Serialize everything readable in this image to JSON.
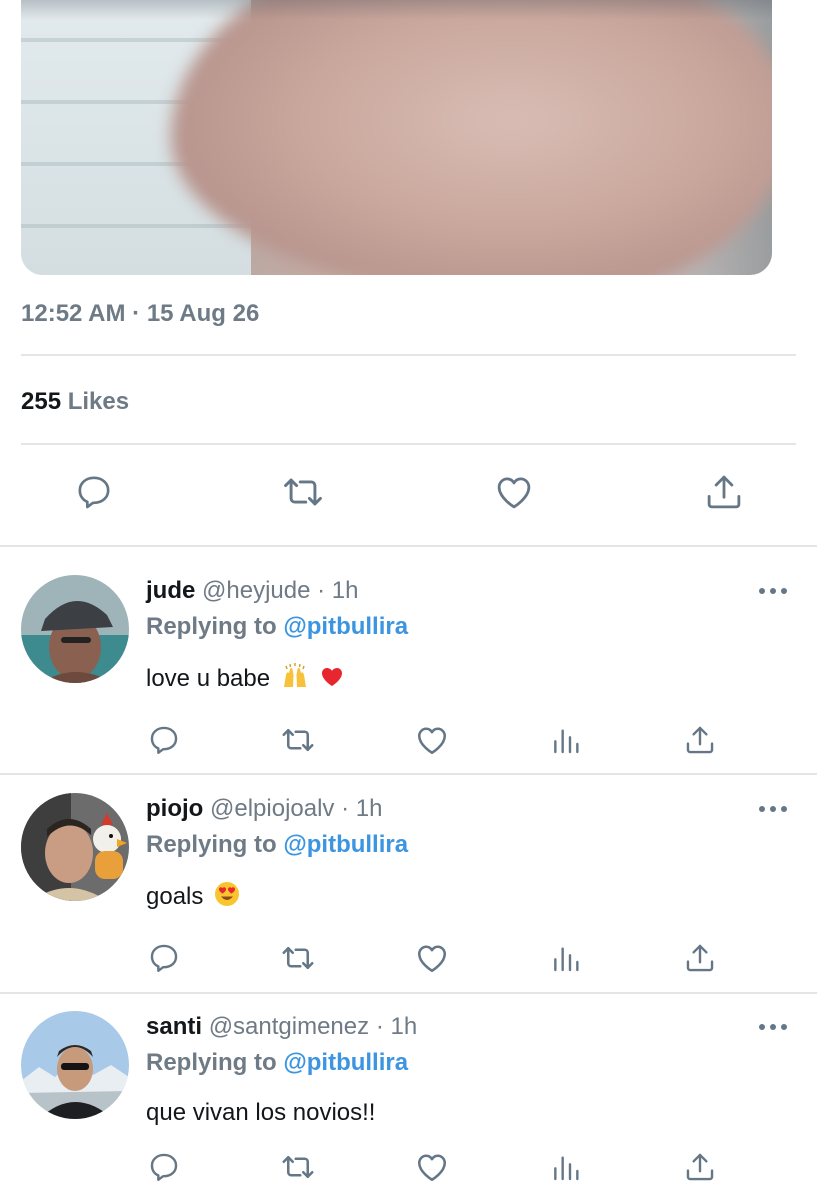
{
  "tweet": {
    "timestamp": "12:52 AM · 15 Aug 26",
    "likes_count": "255",
    "likes_label": "Likes",
    "actions": [
      "reply-icon",
      "retweet-icon",
      "like-icon",
      "share-icon"
    ]
  },
  "replies": [
    {
      "name": "jude",
      "handle": "@heyjude",
      "time": "· 1h",
      "replying_prefix": "Replying to",
      "replying_to": "@pitbullira",
      "text": "love u babe",
      "emojis": [
        "raising-hands-emoji",
        "red-heart-emoji"
      ]
    },
    {
      "name": "piojo",
      "handle": "@elpiojoalv",
      "time": "· 1h",
      "replying_prefix": "Replying to",
      "replying_to": "@pitbullira",
      "text": "goals",
      "emojis": [
        "heart-eyes-emoji"
      ]
    },
    {
      "name": "santi",
      "handle": "@santgimenez",
      "time": "· 1h",
      "replying_prefix": "Replying to",
      "replying_to": "@pitbullira",
      "text": "que vivan los novios!!",
      "emojis": []
    }
  ],
  "colors": {
    "text": "#14171a",
    "muted": "#6e7a85",
    "link": "#3b95e0",
    "divider": "#e3e6e8",
    "icon": "#657786"
  }
}
